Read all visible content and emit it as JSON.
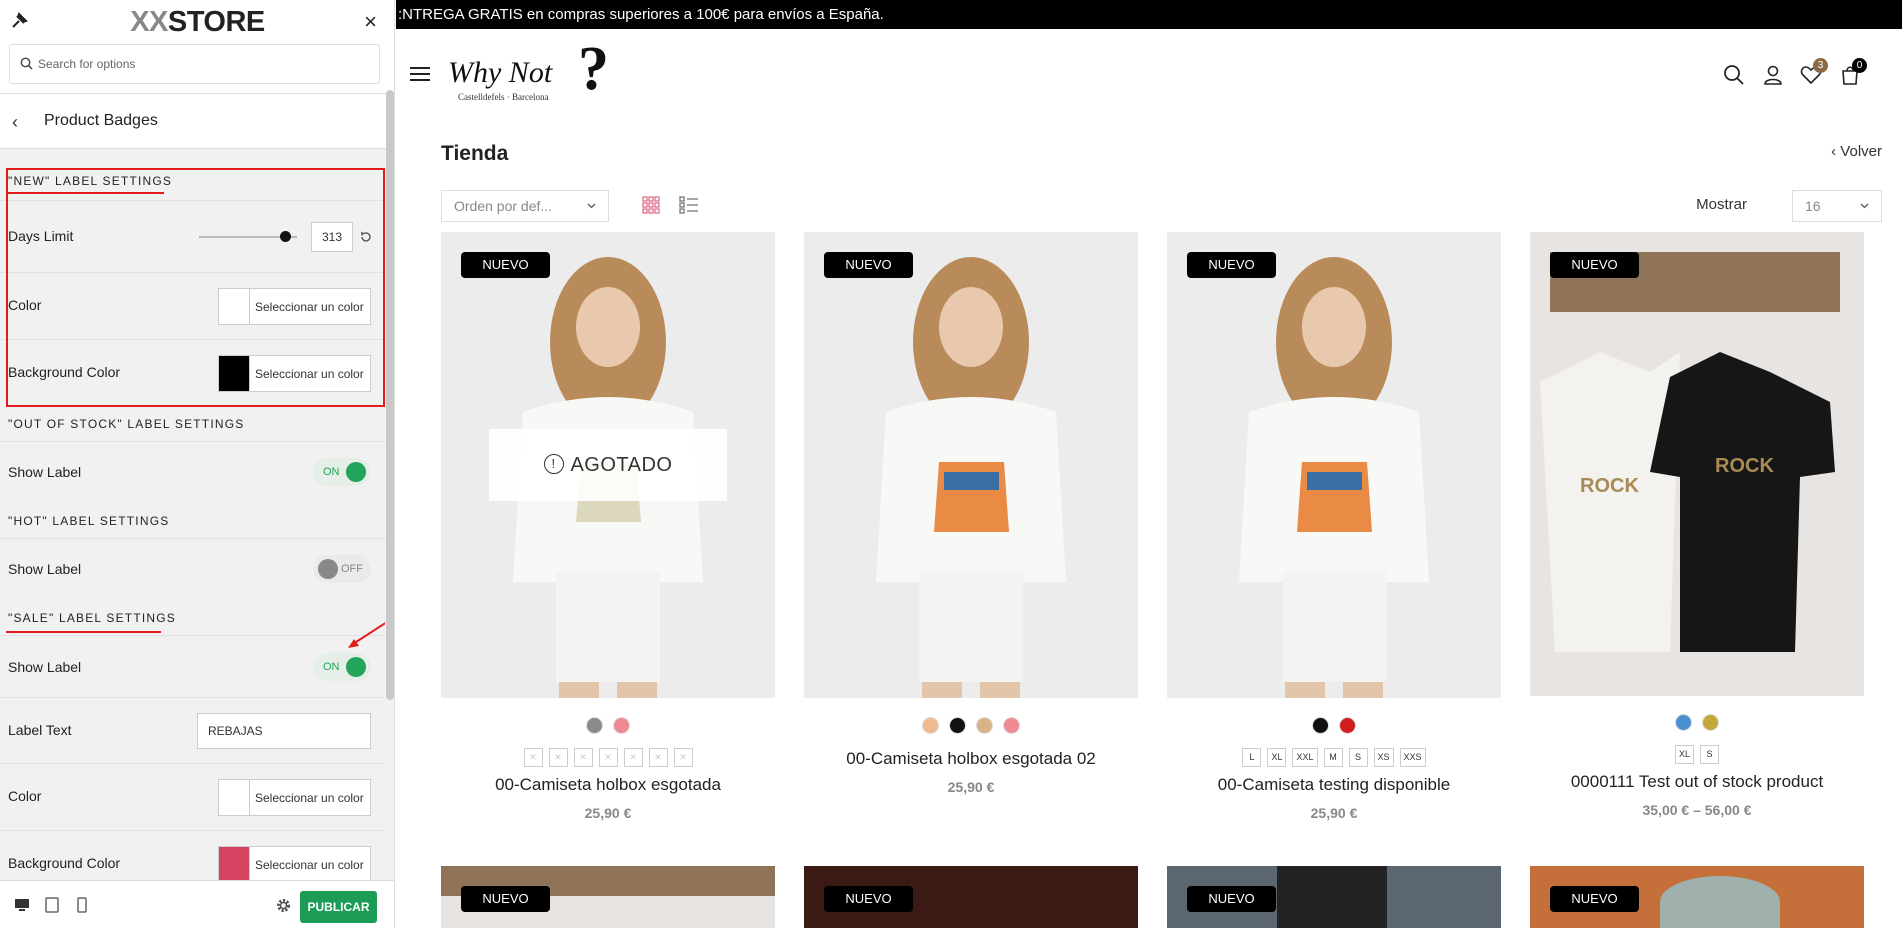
{
  "customizer": {
    "brand_prefix": "XX",
    "brand_suffix": "STORE",
    "close_label": "×",
    "search_placeholder": "Search for options",
    "section_title": "Product Badges",
    "back_label": "‹",
    "new_label": {
      "title": "\"NEW\" LABEL SETTINGS",
      "days_limit_label": "Days Limit",
      "days_limit_value": "313",
      "days_limit_fraction": 0.88,
      "color_label": "Color",
      "color_value": "#ffffff",
      "bg_color_label": "Background Color",
      "bg_color_value": "#000000",
      "picker_text": "Seleccionar un color"
    },
    "out_of_stock": {
      "title": "\"OUT OF STOCK\" LABEL SETTINGS",
      "show_label": "Show Label",
      "toggle_text": "ON",
      "enabled": true
    },
    "hot": {
      "title": "\"HOT\" LABEL SETTINGS",
      "show_label": "Show Label",
      "toggle_text": "OFF",
      "enabled": false
    },
    "sale": {
      "title": "\"SALE\" LABEL SETTINGS",
      "show_label": "Show Label",
      "toggle_text": "ON",
      "enabled": true,
      "label_text_label": "Label Text",
      "label_text_value": "REBAJAS",
      "color_label": "Color",
      "color_value": "#ffffff",
      "bg_color_label": "Background Color",
      "bg_color_value": "#d4435f",
      "picker_text": "Seleccionar un color"
    },
    "publish_label": "PUBLICAR",
    "collapse_label": "‹",
    "accent_color": "#1c9c55",
    "annotation_color": "#e21b1b"
  },
  "store": {
    "topbar_text": ":NTREGA GRATIS en compras superiores a 100€ para envíos a España.",
    "logo_text": "Why Not",
    "logo_mark": "?",
    "logo_sub": "Castelldefels · Barcelona",
    "wishlist_count": "3",
    "cart_count": "0",
    "page_title": "Tienda",
    "back_link": "‹ Volver",
    "sort_value": "Orden por def...",
    "show_label": "Mostrar",
    "show_value": "16",
    "products": [
      {
        "badge": "NUEVO",
        "out_of_stock": "AGOTADO",
        "swatches": [
          "#8a8a8a",
          "#ef8a94"
        ],
        "sizes": [
          "",
          "",
          "",
          "",
          "",
          "",
          "",
          ""
        ],
        "name": "00-Camiseta holbox esgotada",
        "price": "25,90 €"
      },
      {
        "badge": "NUEVO",
        "swatches": [
          "#f2b98c",
          "#111111",
          "#d8b38a",
          "#ef8a94"
        ],
        "sizes": [],
        "name": "00-Camiseta holbox esgotada 02",
        "price": "25,90 €"
      },
      {
        "badge": "NUEVO",
        "swatches": [
          "#111111",
          "#d11d1d"
        ],
        "sizes": [
          "L",
          "XL",
          "XXL",
          "M",
          "S",
          "XS",
          "XXS"
        ],
        "name": "00-Camiseta testing disponible",
        "price": "25,90 €"
      },
      {
        "badge": "NUEVO",
        "swatches": [
          "#4a8fd0",
          "#c4a838"
        ],
        "sizes": [
          "XL",
          "S"
        ],
        "name": "0000111 Test out of stock product",
        "price": "35,00 € – 56,00 €"
      }
    ],
    "row2_badges": [
      "NUEVO",
      "NUEVO",
      "NUEVO",
      "NUEVO"
    ]
  }
}
